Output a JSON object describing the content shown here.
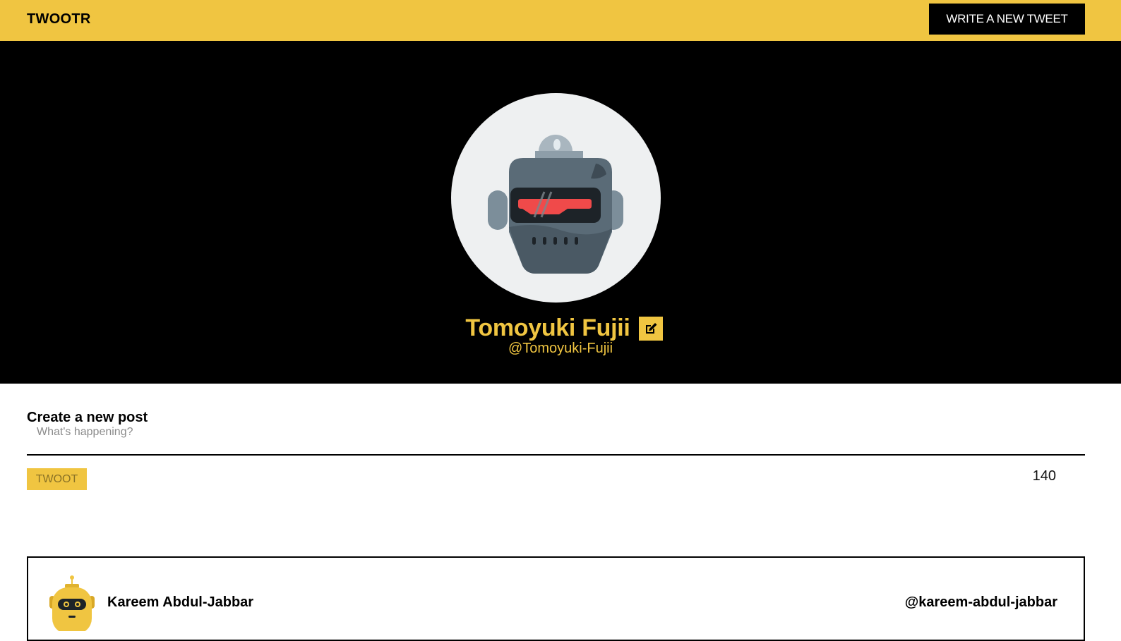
{
  "header": {
    "brand": "TWOOTR",
    "new_tweet_label": "WRITE A NEW TWEET"
  },
  "profile": {
    "name": "Tomoyuki Fujii",
    "handle": "@Tomoyuki-Fujii",
    "avatar_icon": "robot-avatar-icon",
    "edit_icon": "edit-icon"
  },
  "composer": {
    "title": "Create a new post",
    "placeholder": "What's happening?",
    "value": "",
    "submit_label": "TWOOT",
    "char_count": "140"
  },
  "tweets": [
    {
      "name": "Kareem Abdul-Jabbar",
      "handle": "@kareem-abdul-jabbar",
      "avatar_icon": "yellow-robot-avatar-icon"
    }
  ],
  "colors": {
    "accent": "#f0c541",
    "hero_bg": "#000000",
    "text": "#000000"
  }
}
